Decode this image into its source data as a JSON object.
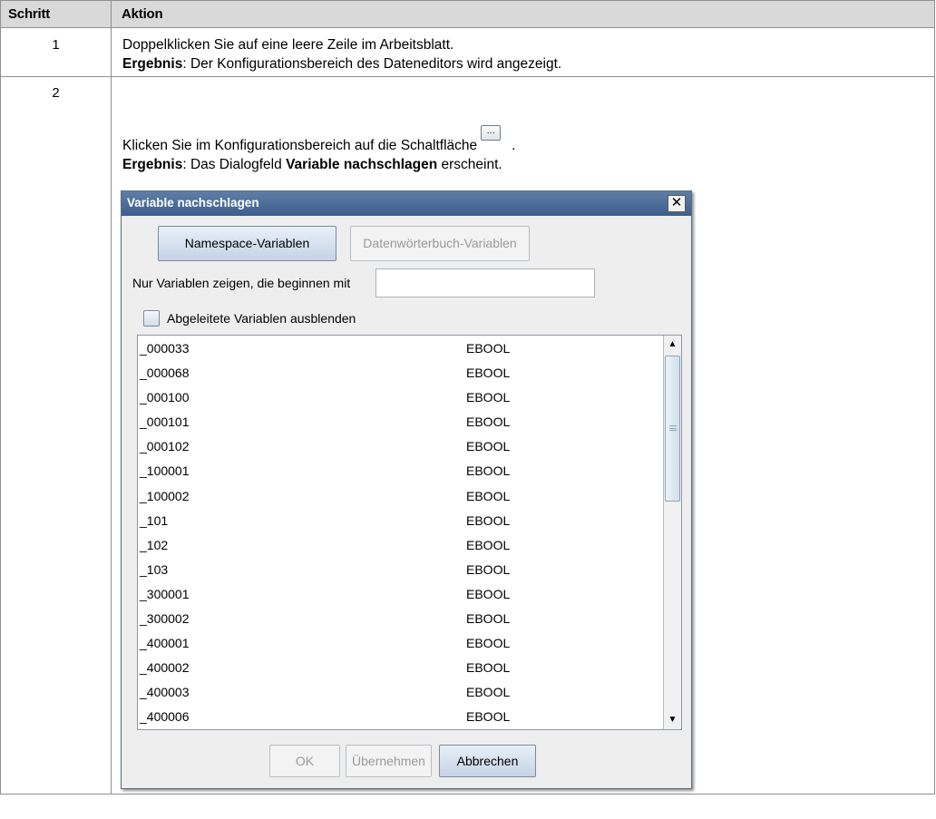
{
  "table": {
    "header": {
      "col_step": "Schritt",
      "col_action": "Aktion"
    },
    "rows": [
      {
        "step": "1",
        "line1": "Doppelklicken Sie auf eine leere Zeile im Arbeitsblatt.",
        "result_label": "Ergebnis",
        "result_text": ": Der Konfigurationsbereich des Dateneditors wird angezeigt."
      },
      {
        "step": "2",
        "line1": "Klicken Sie im Konfigurationsbereich auf die Schaltfläche",
        "line1_button": "...",
        "line1_end": ".",
        "result_label": "Ergebnis",
        "result_text_1": ": Das Dialogfeld ",
        "result_bold": "Variable nachschlagen",
        "result_text_2": " erscheint."
      }
    ]
  },
  "dialog": {
    "title": "Variable nachschlagen",
    "close_symbol": "✕",
    "tabs": [
      {
        "label": "Namespace-Variablen",
        "state": "active"
      },
      {
        "label": "Datenwörterbuch-Variablen",
        "state": "disabled"
      }
    ],
    "filter_label": "Nur Variablen zeigen, die beginnen mit",
    "filter_value": "",
    "checkbox_label": "Abgeleitete Variablen ausblenden",
    "checkbox_checked": false,
    "variables": [
      {
        "name": "_000033",
        "type": "EBOOL"
      },
      {
        "name": "_000068",
        "type": "EBOOL"
      },
      {
        "name": "_000100",
        "type": "EBOOL"
      },
      {
        "name": "_000101",
        "type": "EBOOL"
      },
      {
        "name": "_000102",
        "type": "EBOOL"
      },
      {
        "name": "_100001",
        "type": "EBOOL"
      },
      {
        "name": "_100002",
        "type": "EBOOL"
      },
      {
        "name": "_101",
        "type": "EBOOL"
      },
      {
        "name": "_102",
        "type": "EBOOL"
      },
      {
        "name": "_103",
        "type": "EBOOL"
      },
      {
        "name": "_300001",
        "type": "EBOOL"
      },
      {
        "name": "_300002",
        "type": "EBOOL"
      },
      {
        "name": "_400001",
        "type": "EBOOL"
      },
      {
        "name": "_400002",
        "type": "EBOOL"
      },
      {
        "name": "_400003",
        "type": "EBOOL"
      },
      {
        "name": "_400006",
        "type": "EBOOL"
      }
    ],
    "buttons": {
      "ok": "OK",
      "apply": "Übernehmen",
      "cancel": "Abbrechen"
    }
  },
  "colors": {
    "header_bg": "#d9d9d9",
    "titlebar": "#4a6a96",
    "accent_button": "#c4d3e5",
    "disabled_text": "#9a9a9a"
  }
}
